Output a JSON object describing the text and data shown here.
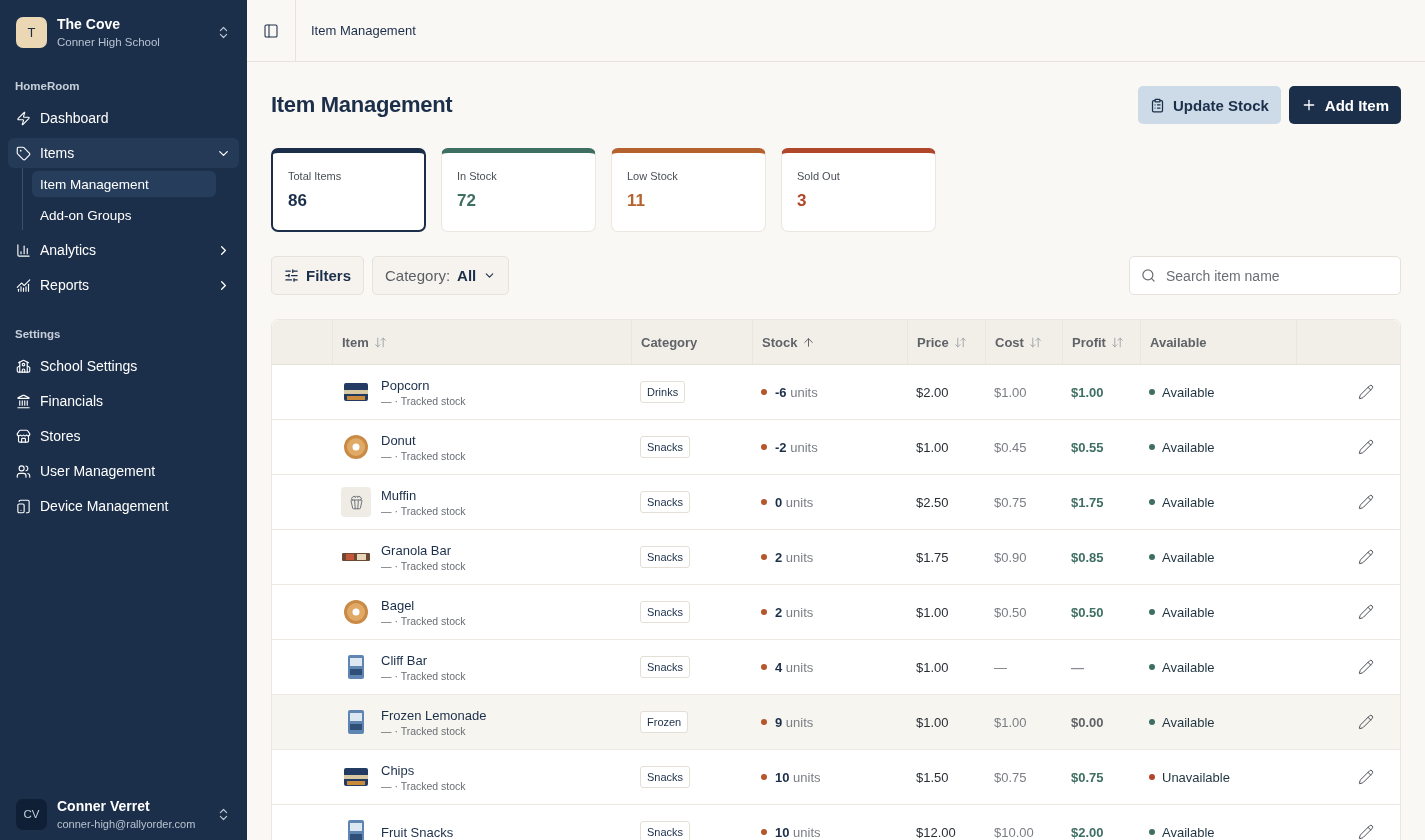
{
  "org": {
    "initial": "T",
    "name": "The Cove",
    "school": "Conner High School"
  },
  "nav_sections": [
    {
      "title": "HomeRoom",
      "items": [
        {
          "label": "Dashboard",
          "selected": false
        },
        {
          "label": "Items",
          "expanded": true,
          "selected": true,
          "children": [
            {
              "label": "Item Management",
              "selected": true
            },
            {
              "label": "Add-on Groups",
              "selected": false
            }
          ]
        },
        {
          "label": "Analytics",
          "expanded": false,
          "selected": false
        },
        {
          "label": "Reports",
          "expanded": false,
          "selected": false
        }
      ]
    },
    {
      "title": "Settings",
      "items": [
        {
          "label": "School Settings",
          "selected": false
        },
        {
          "label": "Financials",
          "selected": false
        },
        {
          "label": "Stores",
          "selected": false
        },
        {
          "label": "User Management",
          "selected": false
        },
        {
          "label": "Device Management",
          "selected": false
        }
      ]
    }
  ],
  "user": {
    "initials": "CV",
    "name": "Conner Verret",
    "email": "conner-high@rallyorder.com"
  },
  "breadcrumb": "Item Management",
  "title": "Item Management",
  "actions": [
    {
      "kind": "secondary",
      "label": "Update Stock"
    },
    {
      "kind": "primary",
      "label": "Add Item"
    }
  ],
  "stats": [
    {
      "label": "Total Items",
      "value": "86",
      "color": "#1c2f4a",
      "selected": true
    },
    {
      "label": "In Stock",
      "value": "72",
      "color": "#3f6e62",
      "selected": false
    },
    {
      "label": "Low Stock",
      "value": "11",
      "color": "#b5622e",
      "selected": false
    },
    {
      "label": "Sold Out",
      "value": "3",
      "color": "#b0462a",
      "selected": false
    }
  ],
  "filters": {
    "button": "Filters",
    "category_label": "Category:",
    "category_value": "All"
  },
  "search": {
    "placeholder": "Search item name"
  },
  "table": {
    "columns": [
      {
        "label": "Item",
        "sortable": true,
        "sorted": false
      },
      {
        "label": "Category"
      },
      {
        "label": "Stock",
        "sortable": true,
        "sorted": true
      },
      {
        "label": "Price",
        "sortable": true,
        "sorted": false
      },
      {
        "label": "Cost",
        "sortable": true,
        "sorted": false
      },
      {
        "label": "Profit",
        "sortable": true,
        "sorted": false
      },
      {
        "label": "Available"
      }
    ],
    "rows": [
      {
        "has_photo": true,
        "name": "Popcorn",
        "sub": "— · Tracked stock",
        "category": "Drinks",
        "stock": "-6",
        "unit": "units",
        "price": "$2.00",
        "cost": "$1.00",
        "profit": {
          "text": "$1.00",
          "color": "#3f6e62"
        },
        "status": {
          "label": "Available",
          "color": "#3f6e62"
        },
        "highlighted": false
      },
      {
        "has_photo": true,
        "name": "Donut",
        "sub": "— · Tracked stock",
        "category": "Snacks",
        "stock": "-2",
        "unit": "units",
        "price": "$1.00",
        "cost": "$0.45",
        "profit": {
          "text": "$0.55",
          "color": "#3f6e62"
        },
        "status": {
          "label": "Available",
          "color": "#3f6e62"
        },
        "highlighted": false
      },
      {
        "has_photo": false,
        "name": "Muffin",
        "sub": "— · Tracked stock",
        "category": "Snacks",
        "stock": "0",
        "unit": "units",
        "price": "$2.50",
        "cost": "$0.75",
        "profit": {
          "text": "$1.75",
          "color": "#3f6e62"
        },
        "status": {
          "label": "Available",
          "color": "#3f6e62"
        },
        "highlighted": false
      },
      {
        "has_photo": true,
        "name": "Granola Bar",
        "sub": "— · Tracked stock",
        "category": "Snacks",
        "stock": "2",
        "unit": "units",
        "price": "$1.75",
        "cost": "$0.90",
        "profit": {
          "text": "$0.85",
          "color": "#3f6e62"
        },
        "status": {
          "label": "Available",
          "color": "#3f6e62"
        },
        "highlighted": false
      },
      {
        "has_photo": true,
        "name": "Bagel",
        "sub": "— · Tracked stock",
        "category": "Snacks",
        "stock": "2",
        "unit": "units",
        "price": "$1.00",
        "cost": "$0.50",
        "profit": {
          "text": "$0.50",
          "color": "#3f6e62"
        },
        "status": {
          "label": "Available",
          "color": "#3f6e62"
        },
        "highlighted": false
      },
      {
        "has_photo": true,
        "name": "Cliff Bar",
        "sub": "— · Tracked stock",
        "category": "Snacks",
        "stock": "4",
        "unit": "units",
        "price": "$1.00",
        "cost": "—",
        "profit": {
          "text": "—",
          "color": "#8a8e94"
        },
        "status": {
          "label": "Available",
          "color": "#3f6e62"
        },
        "highlighted": false
      },
      {
        "has_photo": true,
        "name": "Frozen Lemonade",
        "sub": "— · Tracked stock",
        "category": "Frozen",
        "stock": "9",
        "unit": "units",
        "price": "$1.00",
        "cost": "$1.00",
        "profit": {
          "text": "$0.00",
          "color": "#5f6368"
        },
        "status": {
          "label": "Available",
          "color": "#3f6e62"
        },
        "highlighted": true
      },
      {
        "has_photo": true,
        "name": "Chips",
        "sub": "— · Tracked stock",
        "category": "Snacks",
        "stock": "10",
        "unit": "units",
        "price": "$1.50",
        "cost": "$0.75",
        "profit": {
          "text": "$0.75",
          "color": "#3f6e62"
        },
        "status": {
          "label": "Unavailable",
          "color": "#b0462a"
        },
        "highlighted": false
      },
      {
        "has_photo": true,
        "name": "Fruit Snacks",
        "category": "Snacks",
        "stock": "10",
        "unit": "units",
        "price": "$12.00",
        "cost": "$10.00",
        "profit": {
          "text": "$2.00",
          "color": "#3f6e62"
        },
        "status": {
          "label": "Available",
          "color": "#3f6e62"
        },
        "highlighted": false
      }
    ]
  }
}
